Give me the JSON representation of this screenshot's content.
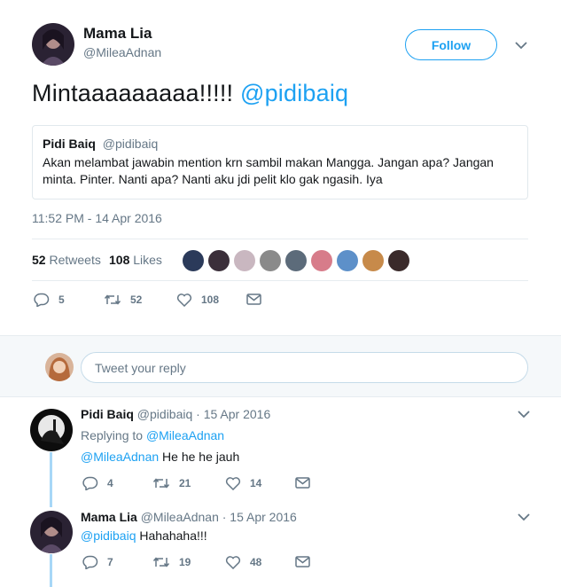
{
  "main_tweet": {
    "author_name": "Mama Lia",
    "author_handle": "@MileaAdnan",
    "follow_label": "Follow",
    "text": "Mintaaaaaaaaa!!!!!",
    "mention": "@pidibaiq",
    "quote": {
      "name": "Pidi Baiq",
      "handle": "@pidibaiq",
      "text": "Akan melambat jawabin mention krn sambil makan Mangga. Jangan apa? Jangan minta. Pinter. Nanti apa? Nanti aku jdi pelit klo gak ngasih. Iya"
    },
    "timestamp": "11:52 PM - 14 Apr 2016",
    "retweets_count": "52",
    "retweets_label": "Retweets",
    "likes_count": "108",
    "likes_label": "Likes",
    "likers_colors": [
      "#2b3a5a",
      "#3b2f3a",
      "#c9b7c0",
      "#8a8a8a",
      "#5c6b7a",
      "#d77c8a",
      "#5d90c9",
      "#c78a4a",
      "#3a2a2a"
    ],
    "actions": {
      "replies": "5",
      "retweets": "52",
      "likes": "108"
    }
  },
  "reply_box": {
    "placeholder": "Tweet your reply"
  },
  "replies": [
    {
      "name": "Pidi Baiq",
      "handle": "@pidibaiq",
      "date": "· 15 Apr 2016",
      "replying_label": "Replying to",
      "replying_to": "@MileaAdnan",
      "mention": "@MileaAdnan",
      "text": "He he he jauh",
      "actions": {
        "replies": "4",
        "retweets": "21",
        "likes": "14"
      }
    },
    {
      "name": "Mama Lia",
      "handle": "@MileaAdnan",
      "date": "· 15 Apr 2016",
      "mention": "@pidibaiq",
      "text": "Hahahaha!!!",
      "actions": {
        "replies": "7",
        "retweets": "19",
        "likes": "48"
      }
    }
  ],
  "colors": {
    "accent": "#1da1f2",
    "muted": "#657786",
    "text": "#14171a",
    "thread": "#a7d7f7"
  }
}
